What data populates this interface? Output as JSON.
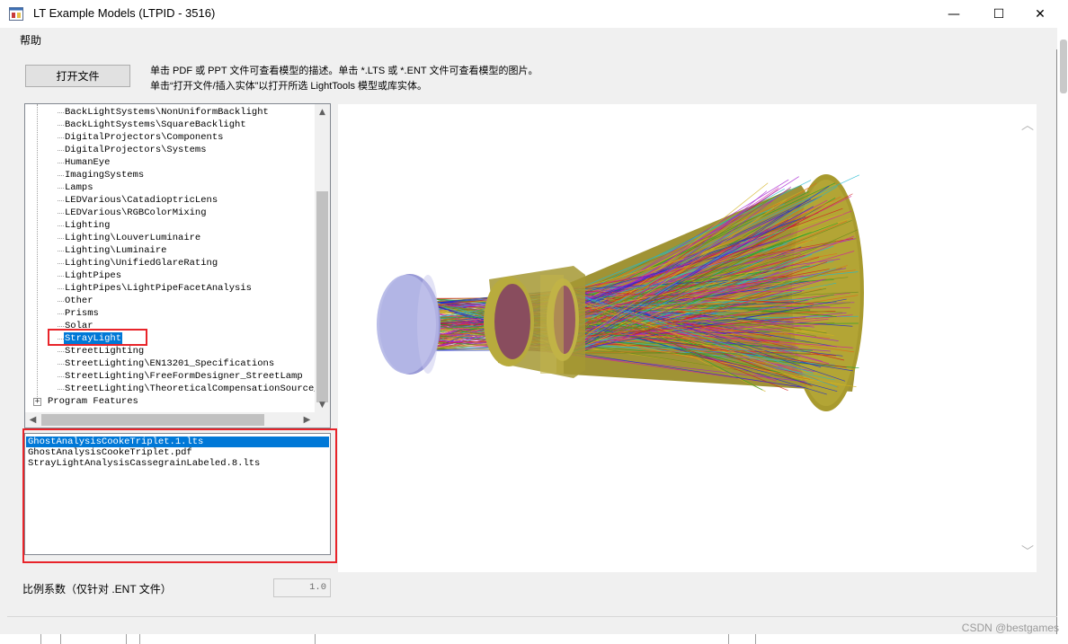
{
  "window": {
    "title": "LT Example Models (LTPID - 3516)",
    "minimize_glyph": "—",
    "maximize_glyph": "☐",
    "close_glyph": "✕"
  },
  "menu": {
    "help": "帮助"
  },
  "toolbar": {
    "open_file_label": "打开文件",
    "instruction_line1": "单击 PDF 或 PPT 文件可查看模型的描述。单击 *.LTS 或 *.ENT 文件可查看模型的图片。",
    "instruction_line2": "单击“打开文件/插入实体”以打开所选 LightTools 模型或库实体。"
  },
  "tree": {
    "items": [
      "BackLightSystems\\NonUniformBacklight",
      "BackLightSystems\\SquareBacklight",
      "DigitalProjectors\\Components",
      "DigitalProjectors\\Systems",
      "HumanEye",
      "ImagingSystems",
      "Lamps",
      "LEDVarious\\CatadioptricLens",
      "LEDVarious\\RGBColorMixing",
      "Lighting",
      "Lighting\\LouverLuminaire",
      "Lighting\\Luminaire",
      "Lighting\\UnifiedGlareRating",
      "LightPipes",
      "LightPipes\\LightPipeFacetAnalysis",
      "Other",
      "Prisms",
      "Solar",
      "StrayLight",
      "StreetLighting",
      "StreetLighting\\EN13201_Specifications",
      "StreetLighting\\FreeFormDesigner_StreetLamp",
      "StreetLighting\\TheoreticalCompensationSource_F"
    ],
    "selected": "StrayLight",
    "root_item": "Program Features",
    "expand_glyph": "+"
  },
  "files": {
    "items": [
      "GhostAnalysisCookeTriplet.1.lts",
      "GhostAnalysisCookeTriplet.pdf",
      "StrayLightAnalysisCassegrainLabeled.8.lts"
    ],
    "selected_index": 0
  },
  "scale": {
    "label": "比例系数（仅针对 .ENT 文件）",
    "value": "1.0"
  },
  "watermark": "CSDN @bestgames",
  "colors": {
    "selection": "#0078d7",
    "highlight_box": "#e8242a",
    "housing": "#a89a2e",
    "lens": "#b4b7e6"
  },
  "icons": {
    "app": "app-window-icon",
    "scroll_up": "chevron-up-icon",
    "scroll_down": "chevron-down-icon"
  }
}
